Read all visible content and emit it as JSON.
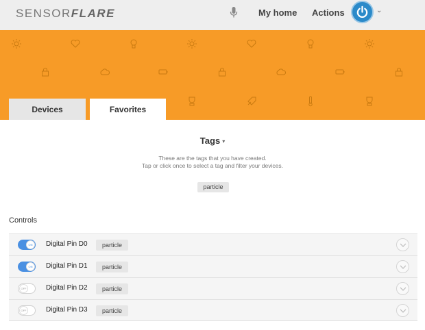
{
  "logo": {
    "part1": "SENSOR",
    "part2": "FLARE"
  },
  "nav": {
    "mic_icon": "microphone-icon",
    "home_label": "My home",
    "actions_label": "Actions",
    "account_icon": "power-icon",
    "account_caret": "⌄"
  },
  "colors": {
    "banner": "#f79b27",
    "toggle_on": "#4a90e2",
    "power_button": "#2b8ac9"
  },
  "banner_icons": [
    "sun-icon",
    "heart-icon",
    "bulb-icon",
    "lock-icon",
    "cloud-icon",
    "battery-icon",
    "trophy-icon",
    "rocket-icon",
    "thermometer-icon"
  ],
  "tabs": [
    {
      "label": "Devices",
      "active": false
    },
    {
      "label": "Favorites",
      "active": true
    }
  ],
  "tags": {
    "title": "Tags",
    "caret": "▾",
    "desc_line1": "These are the tags that you have created.",
    "desc_line2": "Tap or click once to select a tag and filter your devices.",
    "items": [
      "particle"
    ]
  },
  "controls": {
    "title": "Controls",
    "rows": [
      {
        "label": "Digital Pin D0",
        "state": "on",
        "knob_text": "ON",
        "tag": "particle"
      },
      {
        "label": "Digital Pin D1",
        "state": "on",
        "knob_text": "ON",
        "tag": "particle"
      },
      {
        "label": "Digital Pin D2",
        "state": "off",
        "knob_text": "OFF",
        "tag": "particle"
      },
      {
        "label": "Digital Pin D3",
        "state": "off",
        "knob_text": "OFF",
        "tag": "particle"
      }
    ]
  }
}
